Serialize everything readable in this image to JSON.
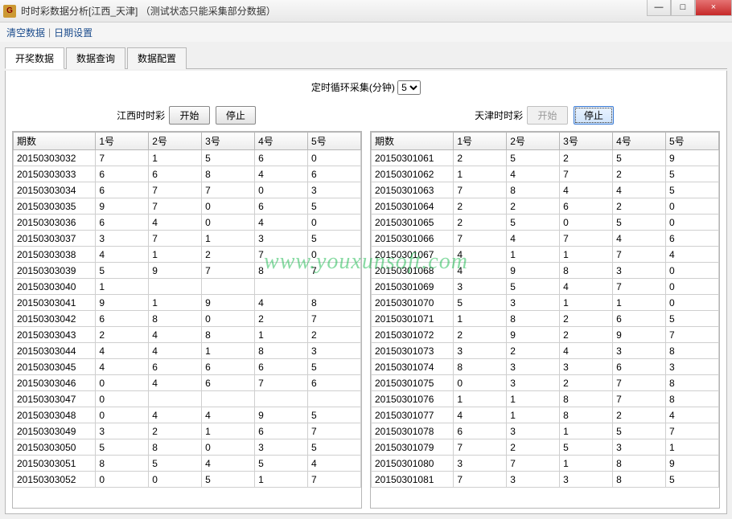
{
  "window": {
    "title": "时时彩数据分析[江西_天津]",
    "title_suffix": "（测试状态只能采集部分数据）",
    "min": "—",
    "max": "□",
    "close": "×"
  },
  "menu": {
    "clear": "清空数据",
    "date": "日期设置"
  },
  "tabs": {
    "t1": "开奖数据",
    "t2": "数据查询",
    "t3": "数据配置"
  },
  "timer": {
    "label": "定时循环采集(分钟)",
    "value": "5"
  },
  "left": {
    "title": "江西时时彩",
    "start": "开始",
    "stop": "停止",
    "start_disabled": false,
    "stop_disabled": false,
    "columns": [
      "期数",
      "1号",
      "2号",
      "3号",
      "4号",
      "5号"
    ],
    "rows": [
      [
        "20150303032",
        "7",
        "1",
        "5",
        "6",
        "0"
      ],
      [
        "20150303033",
        "6",
        "6",
        "8",
        "4",
        "6"
      ],
      [
        "20150303034",
        "6",
        "7",
        "7",
        "0",
        "3"
      ],
      [
        "20150303035",
        "9",
        "7",
        "0",
        "6",
        "5"
      ],
      [
        "20150303036",
        "6",
        "4",
        "0",
        "4",
        "0"
      ],
      [
        "20150303037",
        "3",
        "7",
        "1",
        "3",
        "5"
      ],
      [
        "20150303038",
        "4",
        "1",
        "2",
        "7",
        "0"
      ],
      [
        "20150303039",
        "5",
        "9",
        "7",
        "8",
        "7"
      ],
      [
        "20150303040",
        "1",
        "",
        "",
        "",
        ""
      ],
      [
        "20150303041",
        "9",
        "1",
        "9",
        "4",
        "8"
      ],
      [
        "20150303042",
        "6",
        "8",
        "0",
        "2",
        "7"
      ],
      [
        "20150303043",
        "2",
        "4",
        "8",
        "1",
        "2"
      ],
      [
        "20150303044",
        "4",
        "4",
        "1",
        "8",
        "3"
      ],
      [
        "20150303045",
        "4",
        "6",
        "6",
        "6",
        "5"
      ],
      [
        "20150303046",
        "0",
        "4",
        "6",
        "7",
        "6"
      ],
      [
        "20150303047",
        "0",
        "",
        "",
        "",
        ""
      ],
      [
        "20150303048",
        "0",
        "4",
        "4",
        "9",
        "5"
      ],
      [
        "20150303049",
        "3",
        "2",
        "1",
        "6",
        "7"
      ],
      [
        "20150303050",
        "5",
        "8",
        "0",
        "3",
        "5"
      ],
      [
        "20150303051",
        "8",
        "5",
        "4",
        "5",
        "4"
      ],
      [
        "20150303052",
        "0",
        "0",
        "5",
        "1",
        "7"
      ]
    ]
  },
  "right": {
    "title": "天津时时彩",
    "start": "开始",
    "stop": "停止",
    "start_disabled": true,
    "stop_disabled": false,
    "columns": [
      "期数",
      "1号",
      "2号",
      "3号",
      "4号",
      "5号"
    ],
    "rows": [
      [
        "20150301061",
        "2",
        "5",
        "2",
        "5",
        "9"
      ],
      [
        "20150301062",
        "1",
        "4",
        "7",
        "2",
        "5"
      ],
      [
        "20150301063",
        "7",
        "8",
        "4",
        "4",
        "5"
      ],
      [
        "20150301064",
        "2",
        "2",
        "6",
        "2",
        "0"
      ],
      [
        "20150301065",
        "2",
        "5",
        "0",
        "5",
        "0"
      ],
      [
        "20150301066",
        "7",
        "4",
        "7",
        "4",
        "6"
      ],
      [
        "20150301067",
        "4",
        "1",
        "1",
        "7",
        "4"
      ],
      [
        "20150301068",
        "4",
        "9",
        "8",
        "3",
        "0"
      ],
      [
        "20150301069",
        "3",
        "5",
        "4",
        "7",
        "0"
      ],
      [
        "20150301070",
        "5",
        "3",
        "1",
        "1",
        "0"
      ],
      [
        "20150301071",
        "1",
        "8",
        "2",
        "6",
        "5"
      ],
      [
        "20150301072",
        "2",
        "9",
        "2",
        "9",
        "7"
      ],
      [
        "20150301073",
        "3",
        "2",
        "4",
        "3",
        "8"
      ],
      [
        "20150301074",
        "8",
        "3",
        "3",
        "6",
        "3"
      ],
      [
        "20150301075",
        "0",
        "3",
        "2",
        "7",
        "8"
      ],
      [
        "20150301076",
        "1",
        "1",
        "8",
        "7",
        "8"
      ],
      [
        "20150301077",
        "4",
        "1",
        "8",
        "2",
        "4"
      ],
      [
        "20150301078",
        "6",
        "3",
        "1",
        "5",
        "7"
      ],
      [
        "20150301079",
        "7",
        "2",
        "5",
        "3",
        "1"
      ],
      [
        "20150301080",
        "3",
        "7",
        "1",
        "8",
        "9"
      ],
      [
        "20150301081",
        "7",
        "3",
        "3",
        "8",
        "5"
      ]
    ]
  },
  "watermark": "www.youxunsoft.com"
}
